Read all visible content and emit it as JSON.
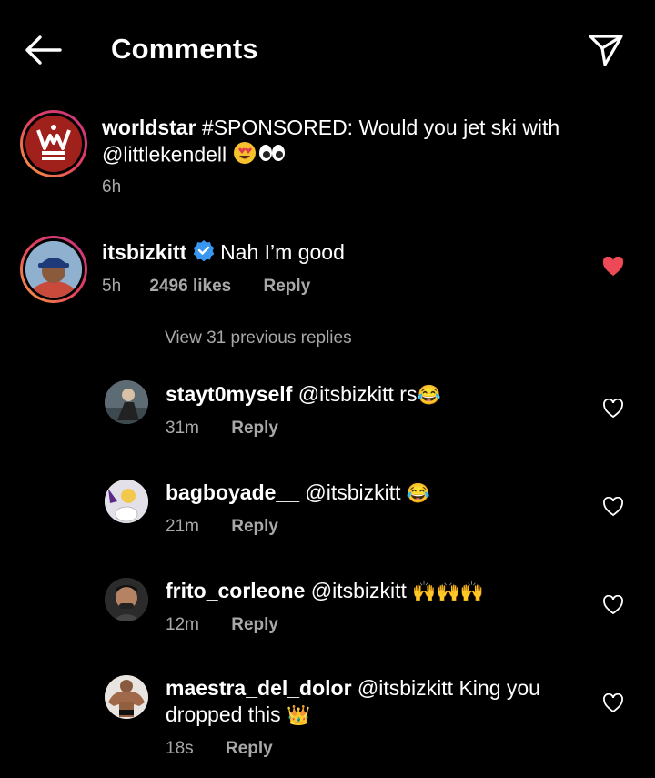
{
  "header": {
    "title": "Comments"
  },
  "post": {
    "username": "worldstar",
    "text": " #SPONSORED: Would you jet ski with",
    "text_line2": "@littlekendell",
    "time": "6h"
  },
  "top_comment": {
    "username": "itsbizkitt",
    "text": "Nah I’m good",
    "time": "5h",
    "likes": "2496 likes",
    "reply_label": "Reply",
    "liked": true
  },
  "view_previous": "View 31 previous replies",
  "replies": [
    {
      "username": "stayt0myself",
      "text": "@itsbizkitt rs",
      "emoji": "😂",
      "time": "31m",
      "reply_label": "Reply"
    },
    {
      "username": "bagboyade__",
      "text": "@itsbizkitt",
      "emoji": "😂",
      "time": "21m",
      "reply_label": "Reply"
    },
    {
      "username": "frito_corleone",
      "text": "@itsbizkitt",
      "emoji": "🙌🙌🙌",
      "time": "12m",
      "reply_label": "Reply"
    },
    {
      "username": "maestra_del_dolor",
      "text": "@itsbizkitt King you",
      "text_line2": "dropped this",
      "emoji": "👑",
      "time": "18s",
      "reply_label": "Reply"
    }
  ],
  "colors": {
    "background": "#000000",
    "secondary_text": "#a8a8a8",
    "like_red": "#ed4956",
    "verified_blue": "#3897f0"
  }
}
